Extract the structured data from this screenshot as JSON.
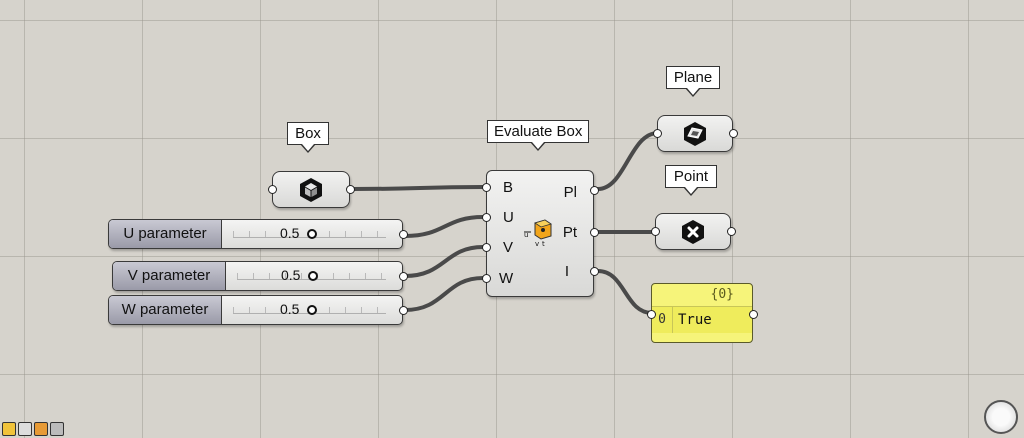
{
  "labels": {
    "box": "Box",
    "evaluate_box": "Evaluate Box",
    "plane": "Plane",
    "point": "Point"
  },
  "evaluate_box": {
    "inputs": [
      "B",
      "U",
      "V",
      "W"
    ],
    "outputs": [
      "Pl",
      "Pt",
      "I"
    ]
  },
  "sliders": [
    {
      "name": "U parameter",
      "value": "0.5"
    },
    {
      "name": "V parameter",
      "value": "0.5"
    },
    {
      "name": "W parameter",
      "value": "0.5"
    }
  ],
  "panel": {
    "path": "{0}",
    "index": "0",
    "value": "True"
  },
  "icons": {
    "box_param": "box-cube-icon",
    "plane_param": "plane-icon",
    "point_param": "point-x-icon",
    "evaluate_box": "evaluate-box-icon",
    "navigation": "canvas-navigation-icon"
  },
  "colors": {
    "canvas": "#d6d3cc",
    "panel": "#f6f47a",
    "slider_name": "#9a9aa8",
    "wire": "#4a4a4a"
  }
}
